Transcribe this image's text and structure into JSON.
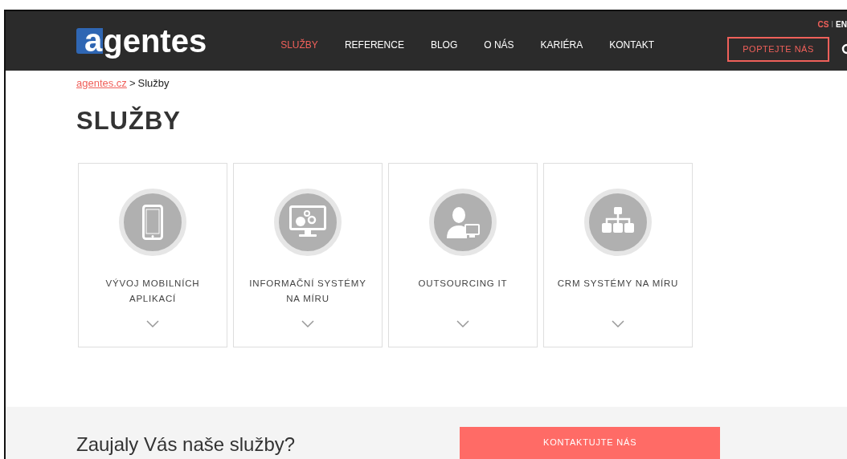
{
  "header": {
    "logo": {
      "first": "a",
      "rest": "gentes"
    },
    "nav": [
      {
        "label": "SLUŽBY",
        "selected": true
      },
      {
        "label": "REFERENCE",
        "selected": false
      },
      {
        "label": "BLOG",
        "selected": false
      },
      {
        "label": "O NÁS",
        "selected": false
      },
      {
        "label": "KARIÉRA",
        "selected": false
      },
      {
        "label": "KONTAKT",
        "selected": false
      }
    ],
    "languages": [
      {
        "label": "CS",
        "selected": true
      },
      {
        "label": "EN",
        "selected": false
      }
    ],
    "language_separator": "I",
    "cta": "POPTEJTE NÁS"
  },
  "breadcrumb": {
    "link": "agentes.cz",
    "separator": ">",
    "current": "Služby"
  },
  "title": "SLUŽBY",
  "services": [
    {
      "label": "VÝVOJ MOBILNÍCH APLIKACÍ"
    },
    {
      "label": "INFORMAČNÍ SYSTÉMY NA MÍRU"
    },
    {
      "label": "OUTSOURCING IT"
    },
    {
      "label": "CRM SYSTÉMY NA MÍRU"
    }
  ],
  "contact": {
    "heading": "Zaujaly Vás naše služby?",
    "button": "KONTAKTUJTE NÁS"
  }
}
